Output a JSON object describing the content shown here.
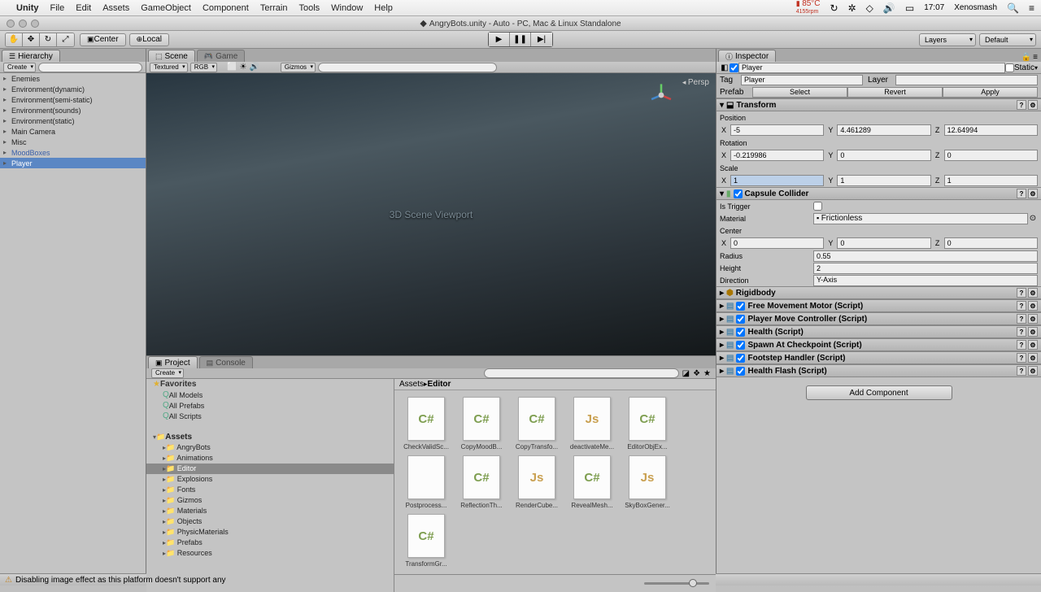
{
  "menubar": {
    "app": "Unity",
    "items": [
      "File",
      "Edit",
      "Assets",
      "GameObject",
      "Component",
      "Terrain",
      "Tools",
      "Window",
      "Help"
    ],
    "temp": "85°C",
    "temp2": "4155rpm",
    "time": "17:07",
    "user": "Xenosmash"
  },
  "window": {
    "title": "AngryBots.unity - Auto - PC, Mac & Linux Standalone"
  },
  "toolbar": {
    "center": "Center",
    "local": "Local",
    "layers": "Layers",
    "layout": "Default"
  },
  "hierarchy": {
    "title": "Hierarchy",
    "create": "Create",
    "items": [
      {
        "label": "Enemies",
        "blue": false
      },
      {
        "label": "Environment(dynamic)",
        "blue": false
      },
      {
        "label": "Environment(semi-static)",
        "blue": false
      },
      {
        "label": "Environment(sounds)",
        "blue": false
      },
      {
        "label": "Environment(static)",
        "blue": false
      },
      {
        "label": "Main Camera",
        "blue": false
      },
      {
        "label": "Misc",
        "blue": false
      },
      {
        "label": "MoodBoxes",
        "blue": true
      },
      {
        "label": "Player",
        "blue": true,
        "selected": true
      }
    ]
  },
  "scene": {
    "tab_scene": "Scene",
    "tab_game": "Game",
    "shading": "Textured",
    "render": "RGB",
    "gizmos": "Gizmos",
    "persp": "Persp"
  },
  "project": {
    "tab_project": "Project",
    "tab_console": "Console",
    "create": "Create",
    "favorites": "Favorites",
    "fav_items": [
      "All Models",
      "All Prefabs",
      "All Scripts"
    ],
    "assets": "Assets",
    "folders": [
      "AngryBots",
      "Animations",
      "Editor",
      "Explosions",
      "Fonts",
      "Gizmos",
      "Materials",
      "Objects",
      "PhysicMaterials",
      "Prefabs",
      "Resources"
    ],
    "selected_folder": "Editor",
    "breadcrumb_root": "Assets",
    "breadcrumb_leaf": "Editor",
    "files": [
      {
        "name": "CheckValidSc...",
        "lang": "C#"
      },
      {
        "name": "CopyMoodB...",
        "lang": "C#"
      },
      {
        "name": "CopyTransfo...",
        "lang": "C#"
      },
      {
        "name": "deactivateMe...",
        "lang": "Js"
      },
      {
        "name": "EditorObjEx...",
        "lang": "C#"
      },
      {
        "name": "Postprocess...",
        "lang": ""
      },
      {
        "name": "ReflectionTh...",
        "lang": "C#"
      },
      {
        "name": "RenderCube...",
        "lang": "Js"
      },
      {
        "name": "RevealMesh...",
        "lang": "C#"
      },
      {
        "name": "SkyBoxGener...",
        "lang": "Js"
      },
      {
        "name": "TransformGr...",
        "lang": "C#"
      }
    ]
  },
  "inspector": {
    "title": "Inspector",
    "name": "Player",
    "static": "Static",
    "tag_label": "Tag",
    "tag": "Player",
    "layer_label": "Layer",
    "layer": "",
    "prefab_label": "Prefab",
    "prefab_select": "Select",
    "prefab_revert": "Revert",
    "prefab_apply": "Apply",
    "transform": {
      "title": "Transform",
      "position": "Position",
      "pos": {
        "x": "-5",
        "y": "4.461289",
        "z": "12.64994"
      },
      "rotation": "Rotation",
      "rot": {
        "x": "-0.219986",
        "y": "0",
        "z": "0"
      },
      "scale": "Scale",
      "scl": {
        "x": "1",
        "y": "1",
        "z": "1"
      }
    },
    "capsule": {
      "title": "Capsule Collider",
      "is_trigger": "Is Trigger",
      "material_label": "Material",
      "material": "Frictionless",
      "center": "Center",
      "cen": {
        "x": "0",
        "y": "0",
        "z": "0"
      },
      "radius_label": "Radius",
      "radius": "0.55",
      "height_label": "Height",
      "height": "2",
      "direction_label": "Direction",
      "direction": "Y-Axis"
    },
    "components": [
      "Rigidbody",
      "Free Movement Motor (Script)",
      "Player Move Controller (Script)",
      "Health (Script)",
      "Spawn At Checkpoint (Script)",
      "Footstep Handler (Script)",
      "Health Flash (Script)"
    ],
    "add_component": "Add Component"
  },
  "status": {
    "message": "Disabling image effect as this platform doesn't support any"
  }
}
